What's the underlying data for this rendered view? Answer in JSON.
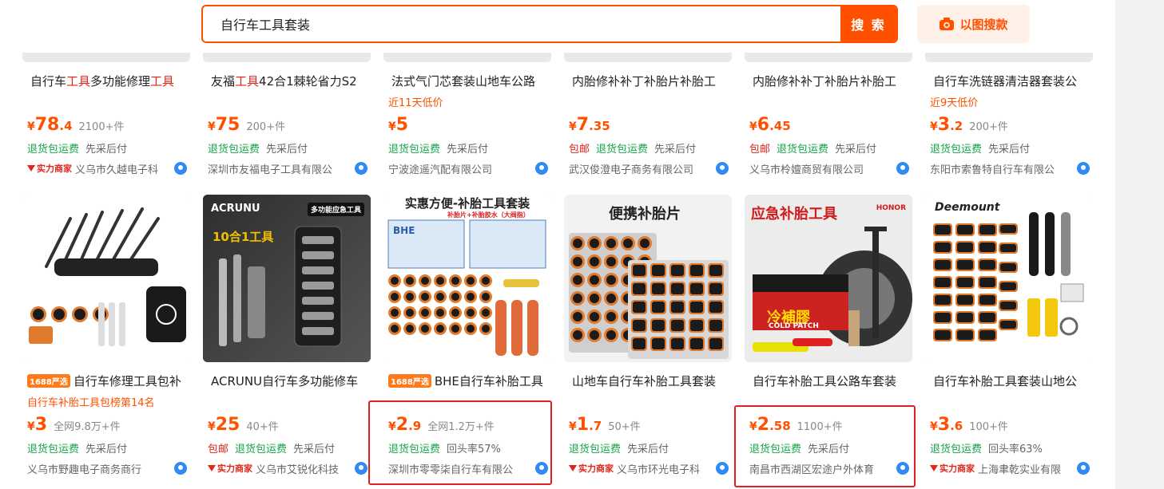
{
  "search": {
    "query": "自行车工具套装",
    "button_label": "搜 索",
    "image_search_label": "以图搜款"
  },
  "row1": [
    {
      "title_pre": "自行车",
      "title_hl1": "工具",
      "title_mid": "多功能修理",
      "title_hl2": "工具",
      "rank": "",
      "price_int": "78",
      "price_dec": ".4",
      "sales": "2100+件",
      "tags": [
        "退货包运费",
        "先采后付"
      ],
      "tag_pre": "",
      "shop_badge": "实力商家",
      "shop": "义乌市久越电子科"
    },
    {
      "title_pre": "友福",
      "title_hl1": "工具",
      "title_mid": "42合1棘轮省力S2",
      "title_hl2": "",
      "rank": "",
      "price_int": "75",
      "price_dec": "",
      "sales": "200+件",
      "tags": [
        "退货包运费",
        "先采后付"
      ],
      "tag_pre": "",
      "shop_badge": "",
      "shop": "深圳市友福电子工具有限公"
    },
    {
      "title_pre": "法式气门芯套装山地车公路",
      "title_hl1": "",
      "title_mid": "",
      "title_hl2": "",
      "rank": "近11天低价",
      "price_int": "5",
      "price_dec": "",
      "sales": "",
      "tags": [
        "退货包运费",
        "先采后付"
      ],
      "tag_pre": "",
      "shop_badge": "",
      "shop": "宁波途遥汽配有限公司"
    },
    {
      "title_pre": "内胎修补补丁补胎片补胎工",
      "title_hl1": "",
      "title_mid": "",
      "title_hl2": "",
      "rank": "",
      "price_int": "7",
      "price_dec": ".35",
      "sales": "",
      "tags": [
        "退货包运费",
        "先采后付"
      ],
      "tag_pre": "包邮",
      "shop_badge": "",
      "shop": "武汉俊澄电子商务有限公司"
    },
    {
      "title_pre": "内胎修补补丁补胎片补胎工",
      "title_hl1": "",
      "title_mid": "",
      "title_hl2": "",
      "rank": "",
      "price_int": "6",
      "price_dec": ".45",
      "sales": "",
      "tags": [
        "退货包运费",
        "先采后付"
      ],
      "tag_pre": "包邮",
      "shop_badge": "",
      "shop": "义乌市柃嬗商贸有限公司"
    },
    {
      "title_pre": "自行车洗链器清洁器套装公",
      "title_hl1": "",
      "title_mid": "",
      "title_hl2": "",
      "rank": "近9天低价",
      "price_int": "3",
      "price_dec": ".2",
      "sales": "200+件",
      "tags": [
        "退货包运费",
        "先采后付"
      ],
      "tag_pre": "",
      "shop_badge": "",
      "shop": "东阳市索鲁特自行车有限公"
    }
  ],
  "row2": [
    {
      "badge": "1688严选",
      "title": "自行车修理工具包补",
      "rank": "自行车补胎工具包榜第14名",
      "price_int": "3",
      "price_dec": "",
      "sales": "全网9.8万+件",
      "tags": [
        "退货包运费",
        "先采后付"
      ],
      "tag_pre": "",
      "shop_badge": "",
      "shop": "义乌市野趣电子商务商行"
    },
    {
      "badge": "",
      "title": "ACRUNU自行车多功能修车",
      "rank": "",
      "price_int": "25",
      "price_dec": "",
      "sales": "40+件",
      "tags": [
        "退货包运费",
        "先采后付"
      ],
      "tag_pre": "包邮",
      "shop_badge": "实力商家",
      "shop": "义乌市艾锐化科技"
    },
    {
      "badge": "1688严选",
      "title": "BHE自行车补胎工具",
      "rank": "",
      "price_int": "2",
      "price_dec": ".9",
      "sales": "全网1.2万+件",
      "tags": [
        "退货包运费",
        "回头率57%"
      ],
      "tag_pre": "",
      "shop_badge": "",
      "shop": "深圳市零零柒自行车有限公"
    },
    {
      "badge": "",
      "title": "山地车自行车补胎工具套装",
      "rank": "",
      "price_int": "1",
      "price_dec": ".7",
      "sales": "50+件",
      "tags": [
        "退货包运费",
        "先采后付"
      ],
      "tag_pre": "",
      "shop_badge": "实力商家",
      "shop": "义乌市环光电子科"
    },
    {
      "badge": "",
      "title": "自行车补胎工具公路车套装",
      "rank": "",
      "price_int": "2",
      "price_dec": ".58",
      "sales": "1100+件",
      "tags": [
        "退货包运费",
        "先采后付"
      ],
      "tag_pre": "",
      "shop_badge": "",
      "shop": "南昌市西湖区宏途户外体育"
    },
    {
      "badge": "",
      "title": "自行车补胎工具套装山地公",
      "rank": "",
      "price_int": "3",
      "price_dec": ".6",
      "sales": "100+件",
      "tags": [
        "退货包运费",
        "回头率63%"
      ],
      "tag_pre": "",
      "shop_badge": "实力商家",
      "shop": "上海聿乾实业有限"
    }
  ],
  "image_texts": {
    "acrunu_brand": "ACRUNU",
    "acrunu_tag": "多功能应急工具",
    "acrunu_sub": "10合1工具",
    "bhe_banner": "实惠方便-补胎工具套装",
    "bhe_sub": "补胎片+补胎胶水（大阀指）",
    "bhe_box": "BHE",
    "portable_banner": "便携补胎片",
    "emergency_banner": "应急补胎工具",
    "cold_patch": "冷補膠",
    "cold_patch_en": "COLD PATCH",
    "deemount": "Deemount",
    "honor": "HONOR",
    "currency": "¥"
  },
  "colors": {
    "accent": "#ff5000",
    "green": "#16a34a",
    "red": "#e1251b",
    "highlight_box": "#e02020"
  }
}
